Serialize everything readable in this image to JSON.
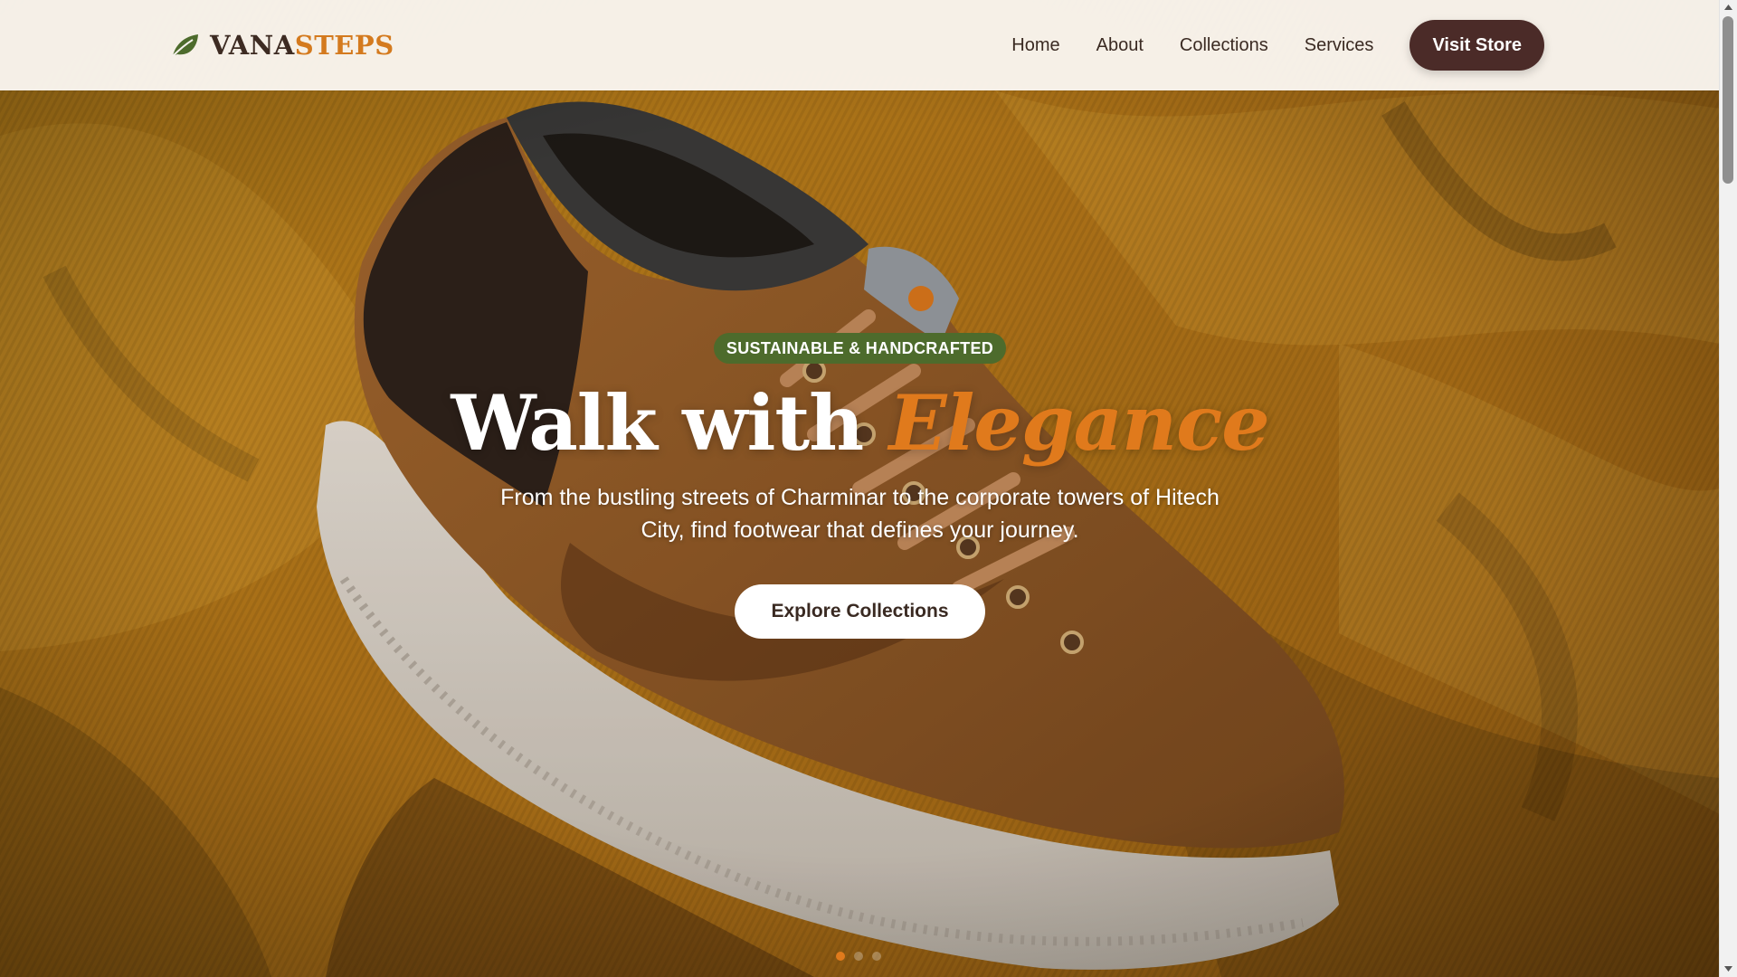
{
  "brand": {
    "name_part1": "VANA",
    "name_part2": "STEPS",
    "icon": "leaf-icon",
    "colors": {
      "dark": "#3d2b22",
      "accent": "#d47a1e",
      "leaf": "#4d6b2c"
    }
  },
  "nav": {
    "links": [
      {
        "label": "Home"
      },
      {
        "label": "About"
      },
      {
        "label": "Collections"
      },
      {
        "label": "Services"
      }
    ],
    "cta_label": "Visit Store",
    "cta_color": "#4b2b28"
  },
  "hero": {
    "badge": "SUSTAINABLE & HANDCRAFTED",
    "headline_main": "Walk with",
    "headline_accent": "Elegance",
    "subtitle": "From the bustling streets of Charminar to the corporate towers of Hitech City, find footwear that defines your journey.",
    "cta_label": "Explore Collections",
    "accent_color": "#e07a1c",
    "badge_color": "#4d6b2c",
    "background_image": "brown canvas sneaker on mustard corduroy fabric",
    "slides": {
      "count": 3,
      "active_index": 0
    }
  },
  "scrollbar": {
    "icons": [
      "scroll-up-arrow-icon",
      "scroll-down-arrow-icon"
    ]
  }
}
